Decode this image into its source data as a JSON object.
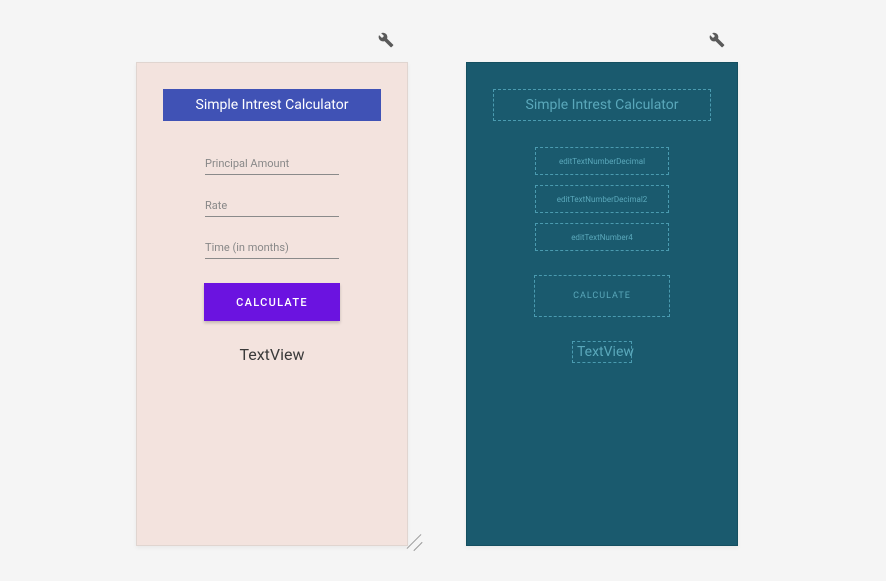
{
  "design": {
    "header": "Simple Intrest Calculator",
    "fields": {
      "principal_placeholder": "Principal Amount",
      "rate_placeholder": "Rate",
      "time_placeholder": "Time (in months)"
    },
    "calculate_label": "CALCULATE",
    "result_label": "TextView"
  },
  "blueprint": {
    "header": "Simple Intrest Calculator",
    "fields": {
      "principal_id": "editTextNumberDecimal",
      "rate_id": "editTextNumberDecimal2",
      "time_id": "editTextNumber4"
    },
    "calculate_label": "CALCULATE",
    "result_label": "TextView"
  },
  "icons": {
    "wrench": "wrench-icon"
  }
}
